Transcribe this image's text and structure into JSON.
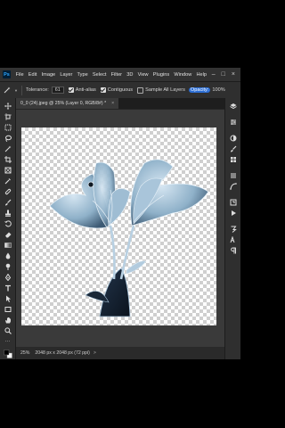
{
  "menubar": {
    "logo": "Ps",
    "items": [
      "File",
      "Edit",
      "Image",
      "Layer",
      "Type",
      "Select",
      "Filter",
      "3D",
      "View",
      "Plugins",
      "Window",
      "Help"
    ]
  },
  "options": {
    "tolerance_label": "Tolerance:",
    "tolerance_value": "61",
    "anti_alias_label": "Anti-alias",
    "contiguous_label": "Contiguous",
    "sample_all_label": "Sample All Layers",
    "opacity_label": "Opacity:",
    "opacity_value": "100%"
  },
  "document": {
    "tab_title": "0_0 (24).jpeg @ 25% (Layer 0, RGB/8#) *",
    "tab_close": "×"
  },
  "status": {
    "zoom": "25%",
    "info": "2048 px x 2048 px (72 ppi)",
    "chevron": ">"
  },
  "colors": {
    "accent": "#2d6fd6",
    "app_bg": "#252525",
    "flower_light": "#b9d2e4",
    "flower_dark": "#15202e"
  },
  "icons": {
    "toolbar": [
      "move-icon",
      "artboard-icon",
      "marquee-icon",
      "lasso-icon",
      "magic-wand-icon",
      "crop-icon",
      "frame-icon",
      "eyedropper-icon",
      "healing-brush-icon",
      "brush-icon",
      "clone-stamp-icon",
      "history-brush-icon",
      "eraser-icon",
      "gradient-icon",
      "blur-icon",
      "dodge-icon",
      "pen-icon",
      "type-icon",
      "path-selection-icon",
      "rectangle-icon",
      "hand-icon",
      "zoom-icon",
      "more-tools-icon",
      "color-swatches-icon"
    ],
    "panels": [
      "layers-icon",
      "properties-icon",
      "adjustments-icon",
      "brushes-icon",
      "libraries-icon",
      "channels-icon",
      "paths-icon",
      "history-icon",
      "actions-icon",
      "glyphs-icon",
      "character-icon",
      "paragraph-icon"
    ]
  }
}
